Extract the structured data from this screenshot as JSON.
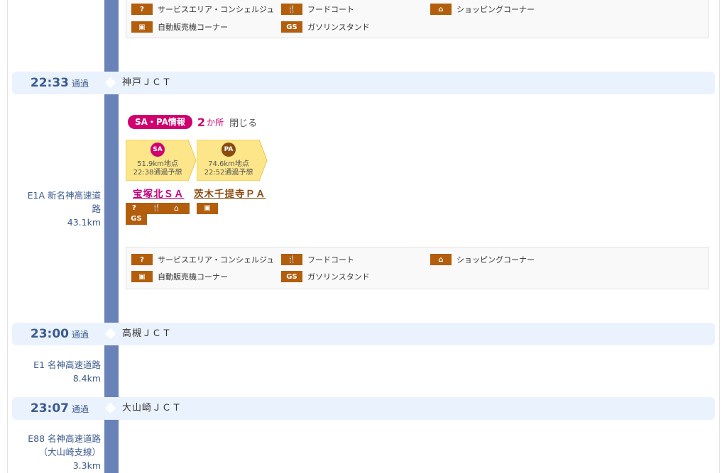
{
  "legend": {
    "concierge": "サービスエリア・コンシェルジュ",
    "food_court": "フードコート",
    "shopping": "ショッピングコーナー",
    "vending": "自動販売機コーナー",
    "gas": "ガソリンスタンド"
  },
  "icons": {
    "concierge": "?",
    "food_court": "🍴",
    "shopping": "⌂",
    "vending": "▣",
    "gas": "GS"
  },
  "stops": [
    {
      "time": "22:33",
      "status": "通過",
      "name": "神戸ＪＣＴ"
    },
    {
      "time": "23:00",
      "status": "通過",
      "name": "高槻ＪＣＴ"
    },
    {
      "time": "23:07",
      "status": "通過",
      "name": "大山崎ＪＣＴ"
    }
  ],
  "segments": [
    {
      "road_line1": "E1A 新名神高速道",
      "road_line2": "路",
      "distance": "43.1km"
    },
    {
      "road": "E1 名神高速道路",
      "distance": "8.4km"
    },
    {
      "road_line1": "E88 名神高速道路",
      "road_line2": "（大山崎支線）",
      "distance": "3.3km"
    }
  ],
  "sa_pa_info": {
    "label": "SA・PA情報",
    "count": "2",
    "count_unit": "か所",
    "close": "閉じる",
    "areas": [
      {
        "badge": "SA",
        "point": "51.9km地点",
        "eta": "22:38通過予想",
        "name": "宝塚北ＳＡ"
      },
      {
        "badge": "PA",
        "point": "74.6km地点",
        "eta": "22:52通過予想",
        "name": "茨木千提寺ＰＡ"
      }
    ]
  },
  "colors": {
    "rail": "#6982b8",
    "accent": "#d0006f",
    "icon": "#b35e0c",
    "row_bg": "#eaf2fd"
  }
}
